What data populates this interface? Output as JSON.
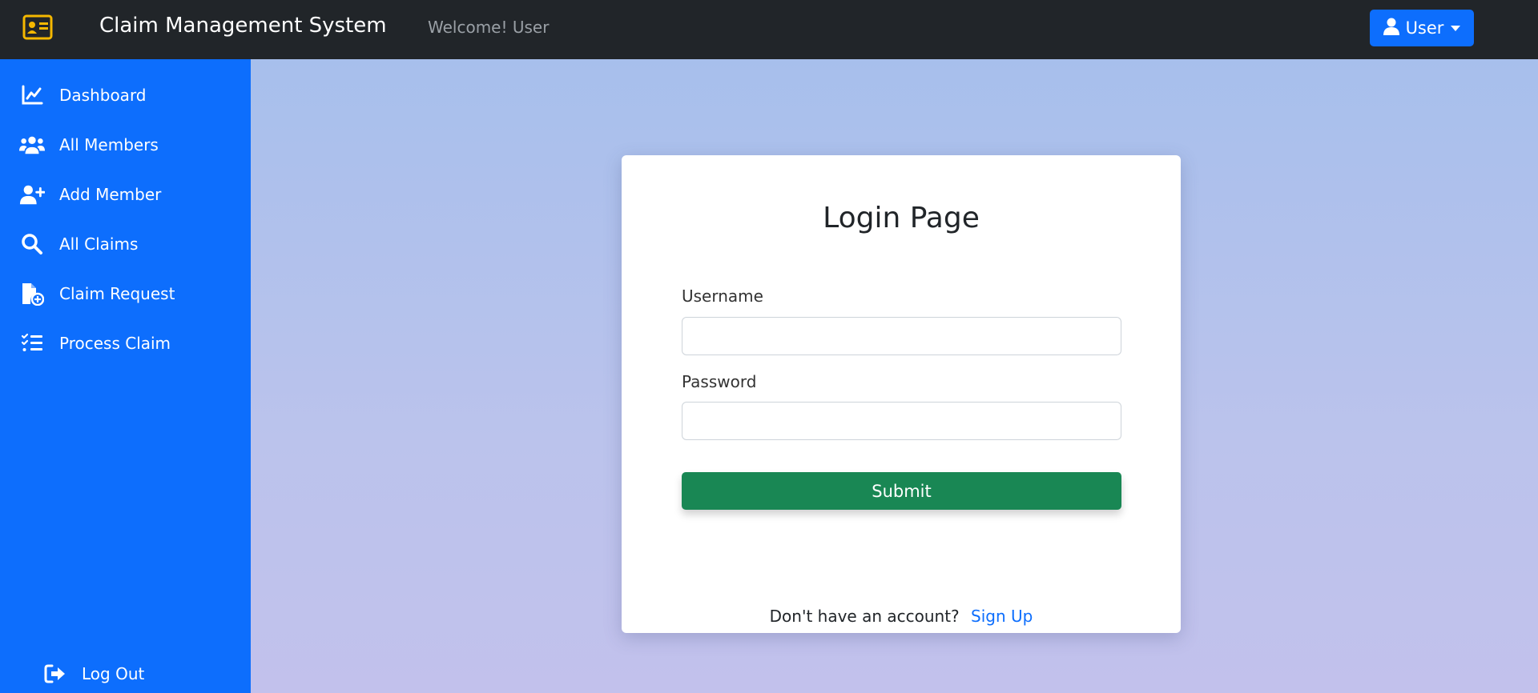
{
  "colors": {
    "navbar_bg": "#212529",
    "sidebar_bg": "#0d6efd",
    "accent": "#0d6efd",
    "submit_bg": "#198754",
    "brand_icon": "#f5b800"
  },
  "header": {
    "brand_icon": "id-card-icon",
    "title": "Claim Management System",
    "welcome": "Welcome! User",
    "user_menu": {
      "icon": "user-icon",
      "label": "User"
    }
  },
  "sidebar": {
    "items": [
      {
        "label": "Dashboard",
        "icon": "chart-line-icon"
      },
      {
        "label": "All Members",
        "icon": "users-icon"
      },
      {
        "label": "Add Member",
        "icon": "user-plus-icon"
      },
      {
        "label": "All Claims",
        "icon": "search-icon"
      },
      {
        "label": "Claim Request",
        "icon": "file-plus-icon"
      },
      {
        "label": "Process Claim",
        "icon": "list-check-icon"
      }
    ],
    "logout": {
      "label": "Log Out",
      "icon": "sign-out-icon"
    }
  },
  "login": {
    "title": "Login Page",
    "username_label": "Username",
    "username_value": "",
    "password_label": "Password",
    "password_value": "",
    "submit_label": "Submit",
    "signup_prompt": "Don't have an account?",
    "signup_link": "Sign Up"
  }
}
